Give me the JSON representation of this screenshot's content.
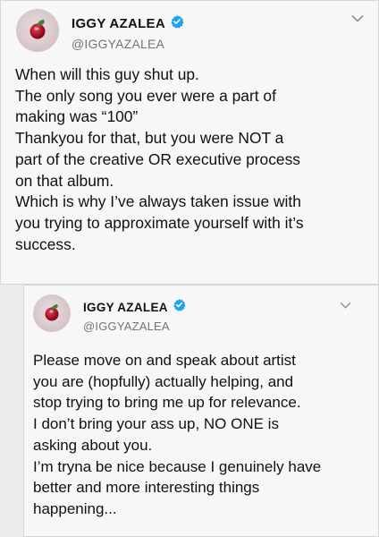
{
  "tweets": [
    {
      "display_name": "IGGY AZALEA",
      "handle": "@IGGYAZALEA",
      "lines": [
        "When will this guy shut up.",
        "The only song you ever were a part of",
        "making was “100”",
        "Thankyou for that, but you were NOT a",
        "part of the creative OR executive process",
        "on that album.",
        "Which is why I’ve always taken issue with",
        "you trying to approximate yourself with it’s",
        "success."
      ]
    },
    {
      "display_name": "IGGY AZALEA",
      "handle": "@IGGYAZALEA",
      "lines": [
        "Please move on and speak about artist",
        "you are (hopfully) actually helping, and",
        "stop trying to bring me up for relevance.",
        "I don’t bring your ass up, NO ONE is",
        "asking about you.",
        "I’m tryna be nice because I genuinely have",
        "better and more interesting things",
        "happening..."
      ]
    }
  ],
  "icons": {
    "verified": "verified-badge-icon",
    "menu": "chevron-down-icon",
    "avatar": "profile-photo"
  },
  "colors": {
    "verified_blue": "#1da1f2",
    "handle_gray": "#6e767d",
    "card_bg": "#f7f7f7"
  }
}
